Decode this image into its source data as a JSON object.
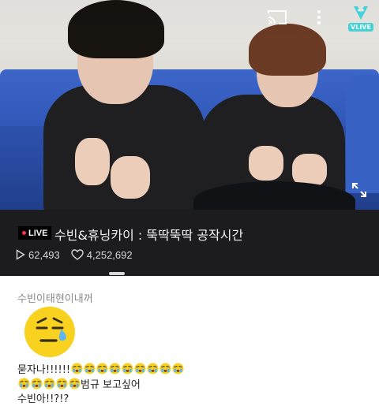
{
  "video": {
    "brand": "VLIVE",
    "icons": [
      "cast-icon",
      "more-vertical-icon",
      "vlive-logo",
      "fullscreen-icon"
    ]
  },
  "broadcast": {
    "live_label": "LIVE",
    "title": "수빈&휴닝카이 : 뚝딱뚝딱 공작시간",
    "views": "62,493",
    "hearts": "4,252,692"
  },
  "chat": {
    "username": "수빈이태현이내꺼",
    "line1": "묻자나!!!!!!",
    "line1_emoji_count": 9,
    "line2_emoji_count": 5,
    "line2_text": "범규 보고싶어",
    "line3": "수빈아!!?!?"
  },
  "colors": {
    "live_dot": "#ff2d4b",
    "vlive_accent": "#44d2d6",
    "panel_bg": "#1c1c1e",
    "emoji_yellow": "#f8d21f"
  }
}
